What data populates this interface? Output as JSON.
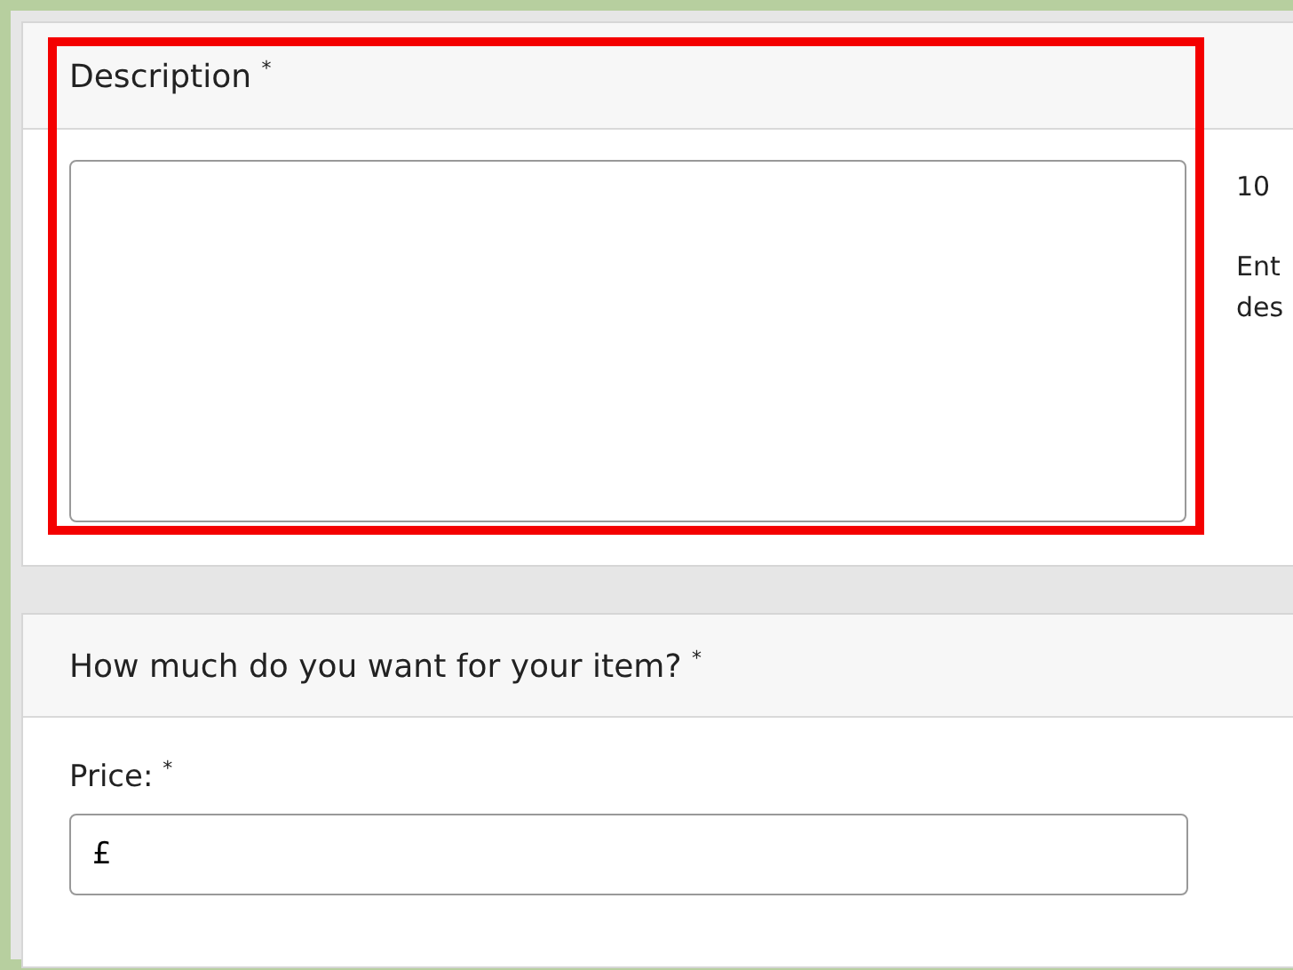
{
  "description_section": {
    "heading": "Description $^{*}$",
    "help_lines": [
      "10",
      "Ent",
      "des"
    ]
  },
  "price_section": {
    "heading": "How much do you want for your item? $^{*}$",
    "label": "Price: $^{*}$",
    "field": {
      "value": "£"
    }
  }
}
